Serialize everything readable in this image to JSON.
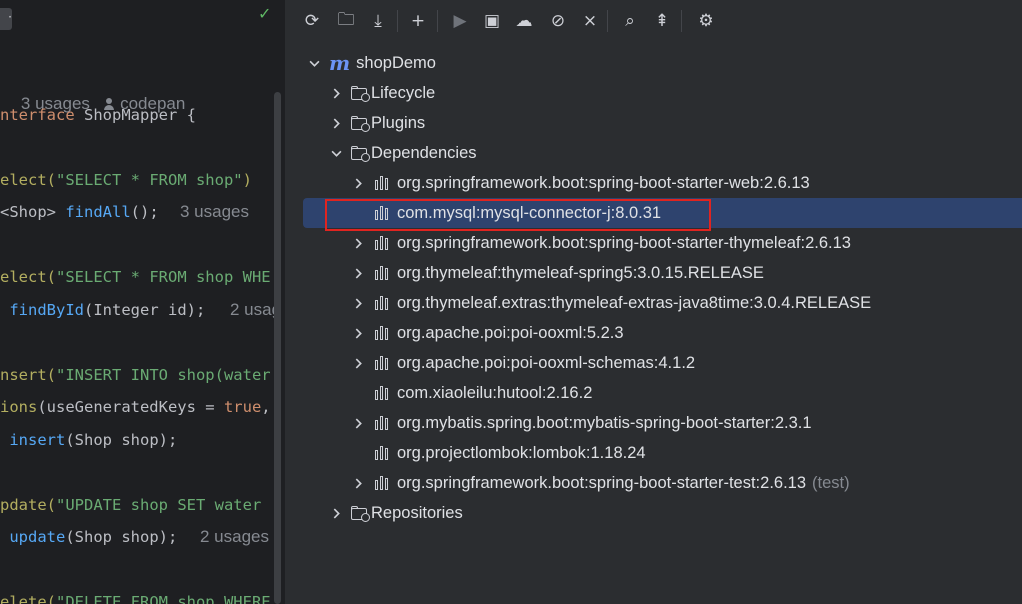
{
  "editor": {
    "usages_hint": "3 usages",
    "author": "codepan",
    "lines": [
      {
        "parts": [
          [
            "kw",
            "nterface "
          ],
          [
            "ty",
            "ShopMapper {"
          ]
        ]
      },
      {
        "parts": [
          [
            "an",
            "elect("
          ],
          [
            "st",
            "\"SELECT * FROM shop\""
          ],
          [
            "an",
            ")"
          ]
        ]
      },
      {
        "parts": [
          [
            "ty",
            "<Shop> "
          ],
          [
            "fn",
            "findAll"
          ],
          [
            "ty",
            "();"
          ]
        ],
        "hint": "3 usages"
      },
      {
        "parts": [
          [
            "an",
            "elect("
          ],
          [
            "st",
            "\"SELECT * FROM shop WHE"
          ]
        ]
      },
      {
        "parts": [
          [
            "ty",
            " "
          ],
          [
            "fn",
            "findById"
          ],
          [
            "ty",
            "(Integer id);"
          ]
        ],
        "hint": "2 usag"
      },
      {
        "parts": [
          [
            "an",
            "nsert("
          ],
          [
            "st",
            "\"INSERT INTO shop(water"
          ]
        ]
      },
      {
        "parts": [
          [
            "an",
            "ions"
          ],
          [
            "ty",
            "(useGeneratedKeys = "
          ],
          [
            "kw",
            "true"
          ],
          [
            "ty",
            ","
          ]
        ]
      },
      {
        "parts": [
          [
            "ty",
            " "
          ],
          [
            "fn",
            "insert"
          ],
          [
            "ty",
            "(Shop shop);"
          ]
        ]
      },
      {
        "parts": [
          [
            "an",
            "pdate("
          ],
          [
            "st",
            "\"UPDATE shop SET water"
          ]
        ]
      },
      {
        "parts": [
          [
            "ty",
            " "
          ],
          [
            "fn",
            "update"
          ],
          [
            "ty",
            "(Shop shop);"
          ]
        ],
        "hint": "2 usages"
      },
      {
        "parts": [
          [
            "an",
            "elete("
          ],
          [
            "st",
            "\"DELETE FROM shop WHERE"
          ]
        ]
      }
    ]
  },
  "maven": {
    "toolbar": [
      {
        "name": "reload-icon",
        "glyph": "⟳"
      },
      {
        "name": "reload-folder-icon",
        "glyph": "🗀"
      },
      {
        "name": "download-icon",
        "glyph": "⤓"
      },
      {
        "name": "add-icon",
        "glyph": "+"
      },
      {
        "name": "run-icon",
        "glyph": "▶"
      },
      {
        "name": "run-config-icon",
        "glyph": "▣"
      },
      {
        "name": "offline-icon",
        "glyph": "☁"
      },
      {
        "name": "skip-tests-icon",
        "glyph": "⊘"
      },
      {
        "name": "collapse-icon",
        "glyph": "⨯"
      },
      {
        "name": "analyze-deps-icon",
        "glyph": "⌕"
      },
      {
        "name": "expand-all-icon",
        "glyph": "⇞"
      },
      {
        "name": "settings-icon",
        "glyph": "⚙"
      }
    ],
    "project": "shopDemo",
    "nodes": [
      {
        "label": "Lifecycle"
      },
      {
        "label": "Plugins"
      },
      {
        "label": "Dependencies"
      }
    ],
    "dependencies": [
      {
        "label": "org.springframework.boot:spring-boot-starter-web:2.6.13",
        "expandable": true
      },
      {
        "label": "com.mysql:mysql-connector-j:8.0.31",
        "expandable": false,
        "selected": true
      },
      {
        "label": "org.springframework.boot:spring-boot-starter-thymeleaf:2.6.13",
        "expandable": true
      },
      {
        "label": "org.thymeleaf:thymeleaf-spring5:3.0.15.RELEASE",
        "expandable": true
      },
      {
        "label": "org.thymeleaf.extras:thymeleaf-extras-java8time:3.0.4.RELEASE",
        "expandable": true
      },
      {
        "label": "org.apache.poi:poi-ooxml:5.2.3",
        "expandable": true
      },
      {
        "label": "org.apache.poi:poi-ooxml-schemas:4.1.2",
        "expandable": true
      },
      {
        "label": "com.xiaoleilu:hutool:2.16.2",
        "expandable": false
      },
      {
        "label": "org.mybatis.spring.boot:mybatis-spring-boot-starter:2.3.1",
        "expandable": true
      },
      {
        "label": "org.projectlombok:lombok:1.18.24",
        "expandable": false
      },
      {
        "label": "org.springframework.boot:spring-boot-starter-test:2.6.13",
        "expandable": true,
        "scope": "(test)"
      }
    ],
    "repositories": "Repositories"
  },
  "colors": {
    "selection": "#2e436e",
    "highlight_border": "#e02420",
    "maven_blue": "#6c94f5"
  }
}
